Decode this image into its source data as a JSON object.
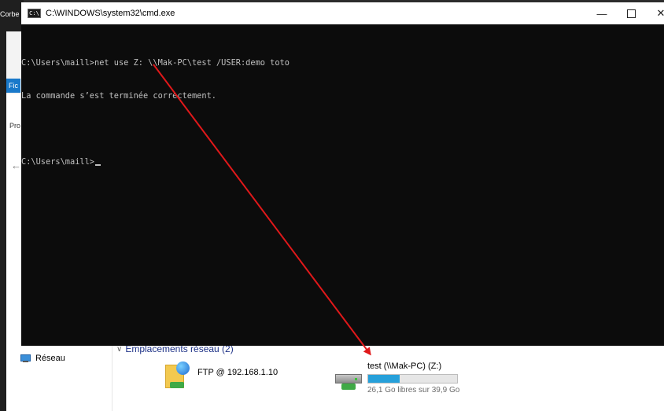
{
  "desktop": {
    "label": "Corbe"
  },
  "explorer": {
    "tab_label": "Fic",
    "side_label": "Pro",
    "back_icon": "arrow-left-icon",
    "nav": {
      "network_label": "Réseau"
    },
    "section_title": "Emplacements réseau (2)",
    "items": [
      {
        "label": "FTP @ 192.168.1.10",
        "icon": "ftp-folder-icon"
      },
      {
        "label": "test (\\\\Mak-PC) (Z:)",
        "free_text": "26,1 Go libres sur 39,9 Go",
        "used_fraction": 0.35,
        "icon": "network-drive-icon"
      }
    ]
  },
  "cmd": {
    "title": "C:\\WINDOWS\\system32\\cmd.exe",
    "icon_text": "C:\\",
    "controls": {
      "minimize": "—",
      "close": "✕"
    },
    "lines": [
      "C:\\Users\\maill>net use Z: \\\\Mak-PC\\test /USER:demo toto",
      "La commande s’est terminée correctement.",
      "",
      "C:\\Users\\maill>"
    ]
  },
  "colors": {
    "annotation": "#e0181a",
    "drive_fill": "#26a0da",
    "console_bg": "#0c0c0c"
  }
}
